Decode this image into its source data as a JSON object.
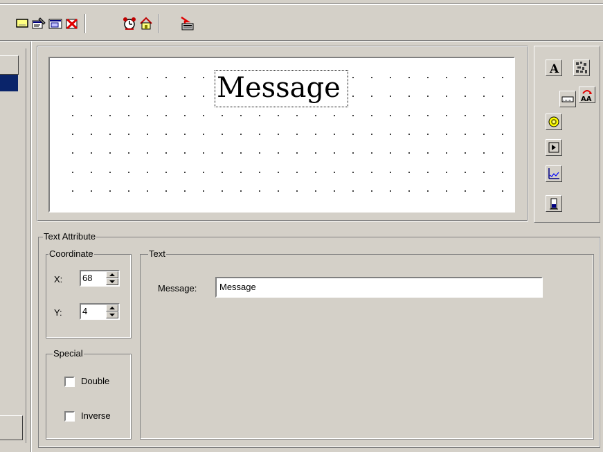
{
  "toolbar": {
    "buttons": [
      {
        "icon": "new-screen-icon"
      },
      {
        "icon": "properties-icon"
      },
      {
        "icon": "screen-list-icon"
      },
      {
        "icon": "delete-screen-icon"
      },
      {
        "icon": "alarm-clock-icon"
      },
      {
        "icon": "home-icon"
      },
      {
        "icon": "download-icon"
      }
    ]
  },
  "canvas": {
    "label_text": "Message"
  },
  "tools": {
    "items": [
      "text-tool-icon",
      "bitmap-tool-icon",
      "input-field-icon",
      "font-size-icon",
      "lamp-icon",
      "button-icon",
      "trend-chart-icon",
      "bar-graph-icon"
    ]
  },
  "attributes": {
    "group_title": "Text Attribute",
    "coordinate": {
      "title": "Coordinate",
      "x_label": "X:",
      "x_value": "68",
      "y_label": "Y:",
      "y_value": "4"
    },
    "special": {
      "title": "Special",
      "double_label": "Double",
      "inverse_label": "Inverse",
      "double_checked": false,
      "inverse_checked": false
    },
    "text": {
      "title": "Text",
      "message_label": "Message:",
      "message_value": "Message"
    }
  },
  "colors": {
    "face": "#d4d0c8",
    "selection": "#0a246a",
    "shadow": "#808080",
    "highlight": "#ffffff"
  }
}
